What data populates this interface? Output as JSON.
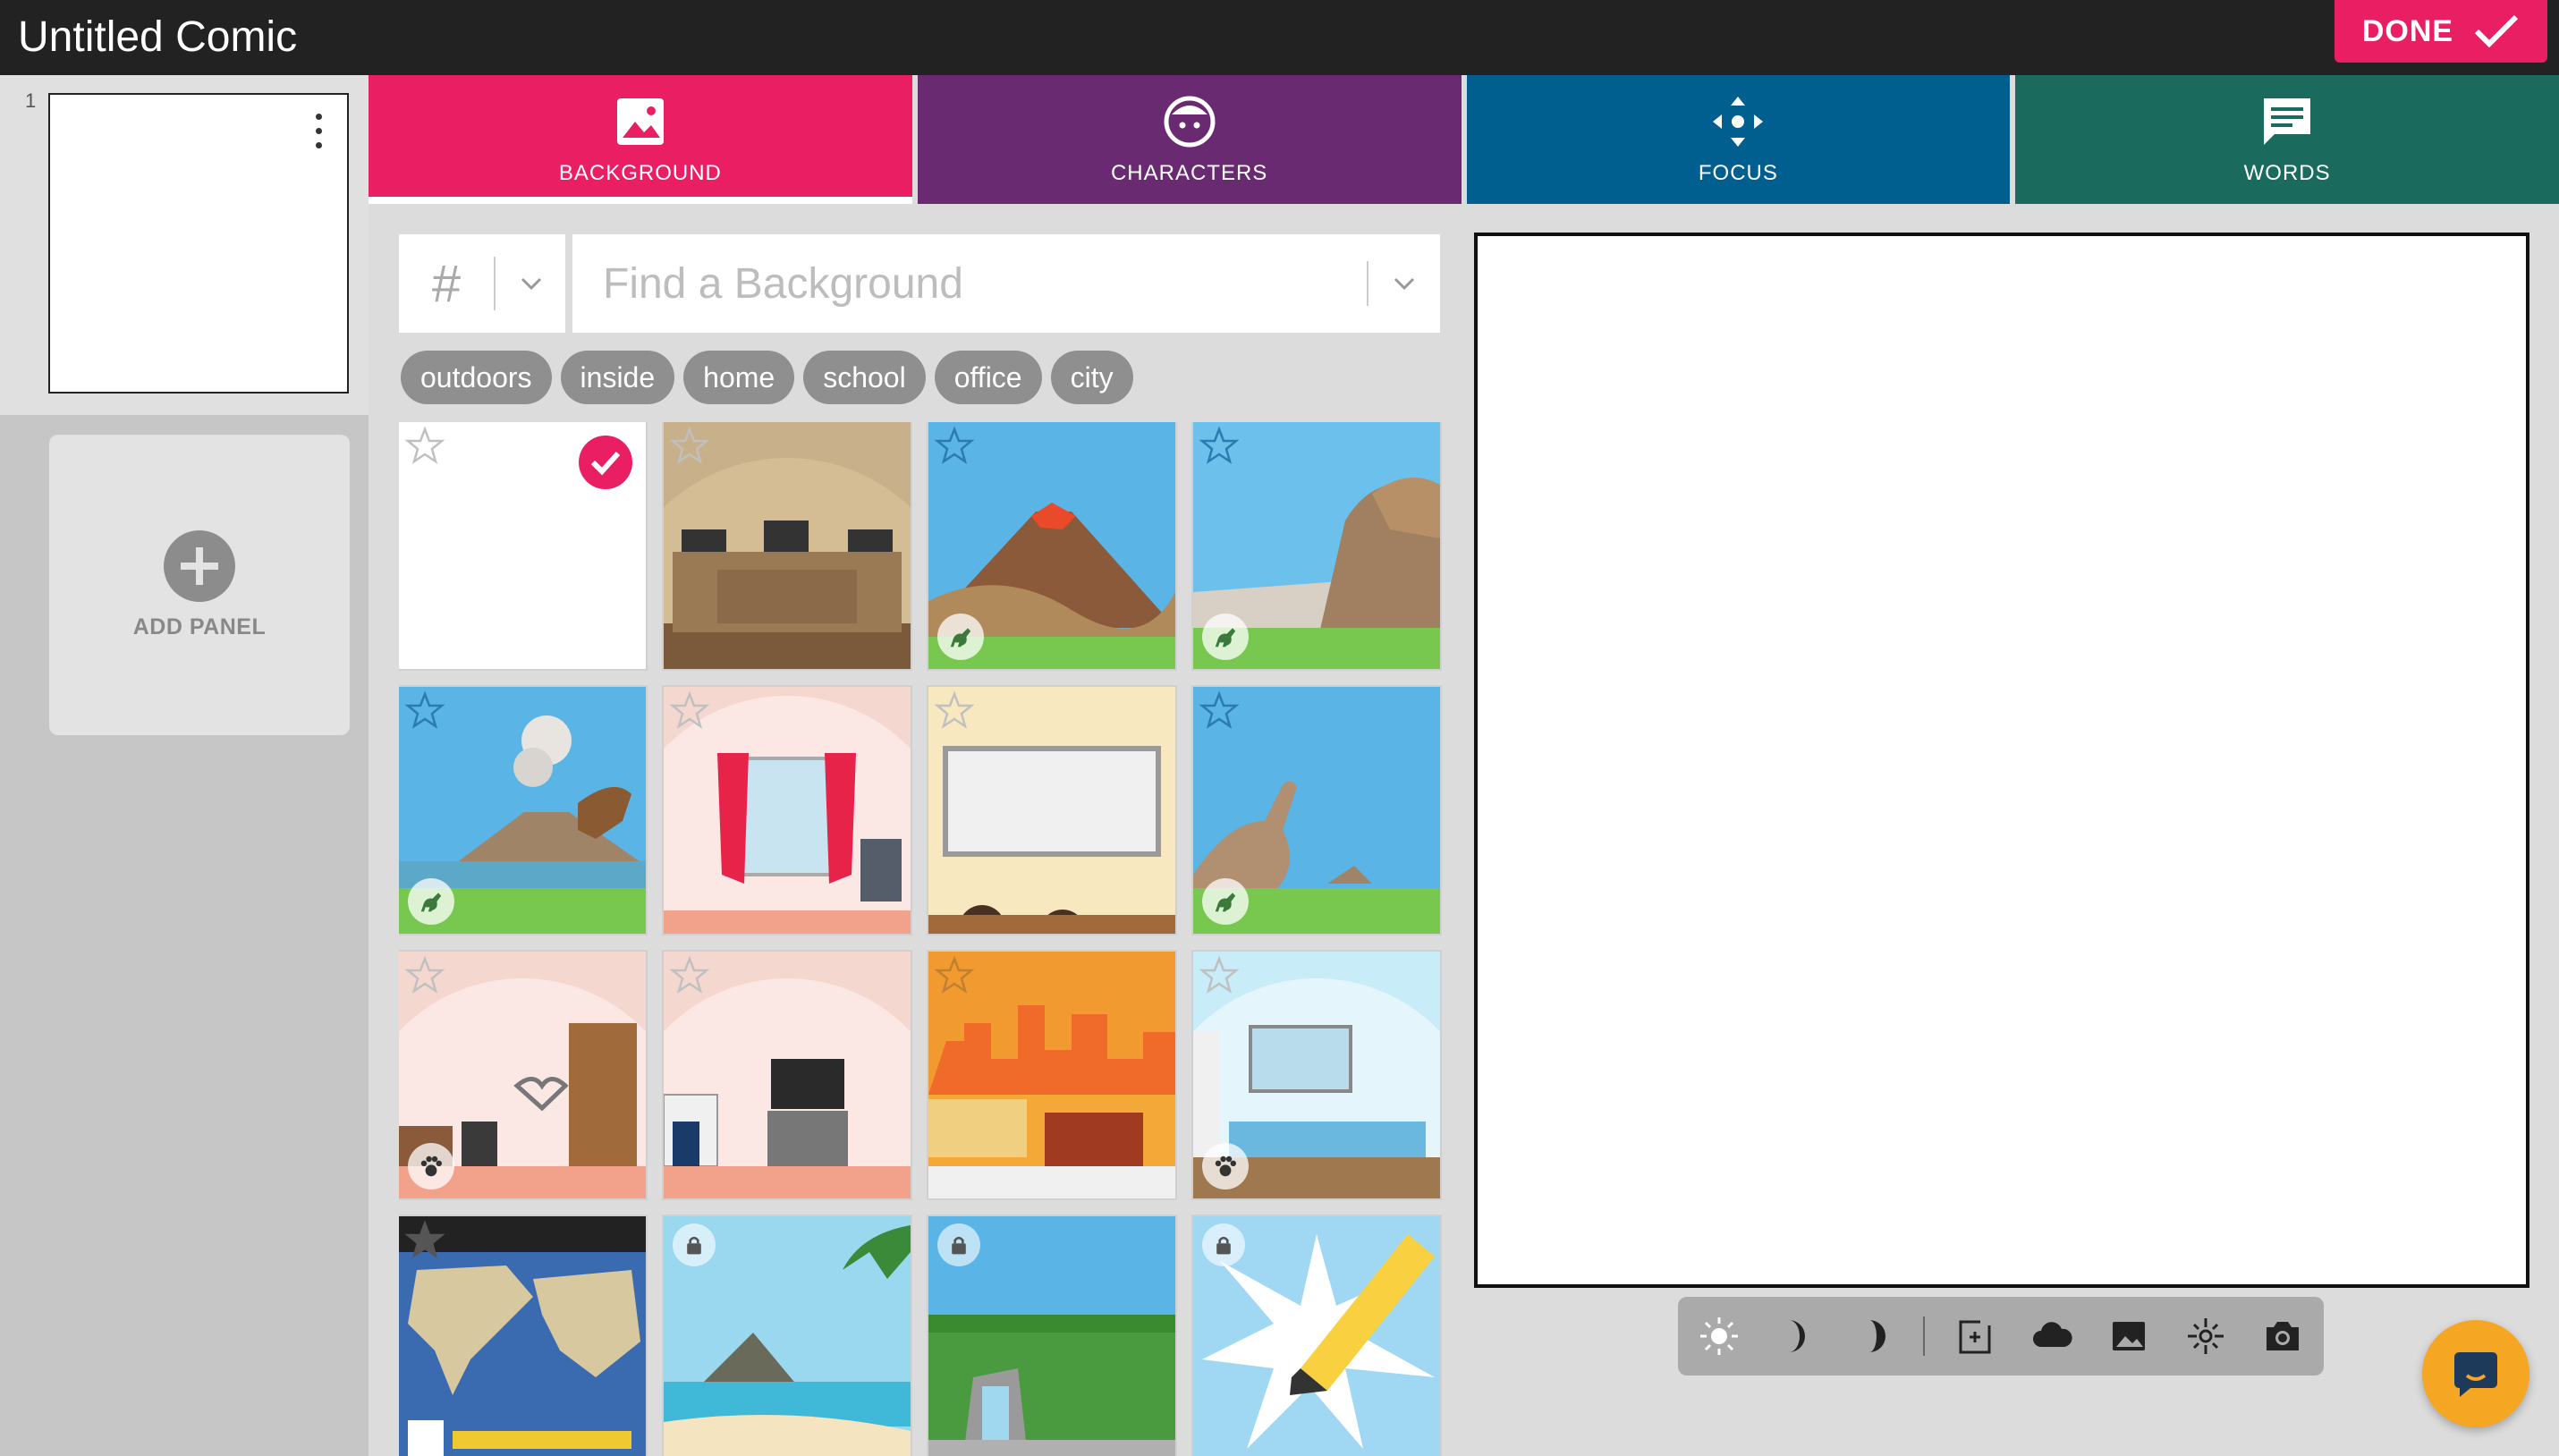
{
  "app": {
    "title": "Untitled Comic",
    "done_label": "DONE"
  },
  "sidebar": {
    "panel_number": "1",
    "add_panel_label": "ADD PANEL"
  },
  "tabs": [
    {
      "label": "BACKGROUND",
      "icon": "image-icon",
      "color": "#e91e63",
      "active": true
    },
    {
      "label": "CHARACTERS",
      "icon": "face-icon",
      "color": "#6a2a72",
      "active": false
    },
    {
      "label": "FOCUS",
      "icon": "move-arrows-icon",
      "color": "#005f8f",
      "active": false
    },
    {
      "label": "WORDS",
      "icon": "speech-bubble-icon",
      "color": "#1a6b5e",
      "active": false
    }
  ],
  "search": {
    "hash_symbol": "#",
    "placeholder": "Find a Background"
  },
  "chips": [
    "outdoors",
    "inside",
    "home",
    "school",
    "office",
    "city"
  ],
  "backgrounds": [
    {
      "name": "blank",
      "selected": true
    },
    {
      "name": "courtroom"
    },
    {
      "name": "volcano-hills",
      "badge": "dinosaur"
    },
    {
      "name": "dinosaur-cave",
      "badge": "dinosaur"
    },
    {
      "name": "dinosaur-volcano",
      "badge": "dinosaur"
    },
    {
      "name": "window-curtains"
    },
    {
      "name": "classroom-whiteboard"
    },
    {
      "name": "dinosaur-plains",
      "badge": "dinosaur"
    },
    {
      "name": "bedroom-wardrobe",
      "badge": "pet"
    },
    {
      "name": "bedroom-tv"
    },
    {
      "name": "city-office"
    },
    {
      "name": "bedroom-window",
      "badge": "pet"
    },
    {
      "name": "world-map"
    },
    {
      "name": "beach-island",
      "locked": true
    },
    {
      "name": "garden-waterfall",
      "locked": true
    },
    {
      "name": "pencil-burst",
      "locked": true
    }
  ],
  "colors": {
    "accent": "#e91e63",
    "topbar": "#222222",
    "chat": "#f5a623"
  }
}
